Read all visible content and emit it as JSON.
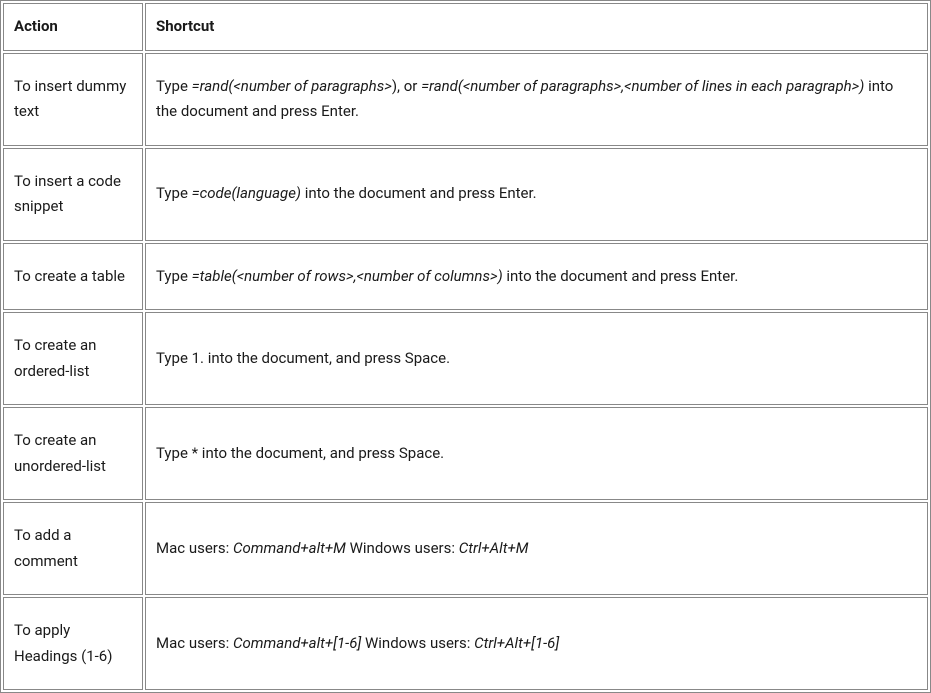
{
  "table": {
    "headers": {
      "action": "Action",
      "shortcut": "Shortcut"
    },
    "rows": [
      {
        "action": "To insert dummy text",
        "shortcut": {
          "parts": [
            {
              "text": "Type ",
              "italic": false
            },
            {
              "text": "=rand(<number of paragraphs>",
              "italic": true
            },
            {
              "text": "), or ",
              "italic": false
            },
            {
              "text": "=rand(<number of paragraphs>,<number of lines in each paragraph>)",
              "italic": true
            },
            {
              "text": " into the document and press Enter.",
              "italic": false
            }
          ]
        }
      },
      {
        "action": "To insert a code snippet",
        "shortcut": {
          "parts": [
            {
              "text": "Type ",
              "italic": false
            },
            {
              "text": "=code(language)",
              "italic": true
            },
            {
              "text": " into the document and press Enter.",
              "italic": false
            }
          ]
        }
      },
      {
        "action": "To create a table",
        "shortcut": {
          "parts": [
            {
              "text": "Type ",
              "italic": false
            },
            {
              "text": "=table(<number of rows>,<number of columns>)",
              "italic": true
            },
            {
              "text": " into the document and press Enter.",
              "italic": false
            }
          ]
        }
      },
      {
        "action": "To create an ordered-list",
        "shortcut": {
          "parts": [
            {
              "text": "Type 1. into the document, and press Space.",
              "italic": false
            }
          ]
        }
      },
      {
        "action": "To create an unordered-list",
        "shortcut": {
          "parts": [
            {
              "text": "Type * into the document, and press Space.",
              "italic": false
            }
          ]
        }
      },
      {
        "action": "To add a comment",
        "shortcut": {
          "parts": [
            {
              "text": "Mac users: ",
              "italic": false
            },
            {
              "text": "Command+alt+M",
              "italic": true
            },
            {
              "text": " Windows users: ",
              "italic": false
            },
            {
              "text": "Ctrl+Alt+M",
              "italic": true
            }
          ]
        }
      },
      {
        "action": "To apply Headings (1-6)",
        "shortcut": {
          "parts": [
            {
              "text": "Mac users: ",
              "italic": false
            },
            {
              "text": "Command+alt+[1-6]",
              "italic": true
            },
            {
              "text": " Windows users: ",
              "italic": false
            },
            {
              "text": "Ctrl+Alt+[1-6]",
              "italic": true
            }
          ]
        }
      }
    ]
  }
}
